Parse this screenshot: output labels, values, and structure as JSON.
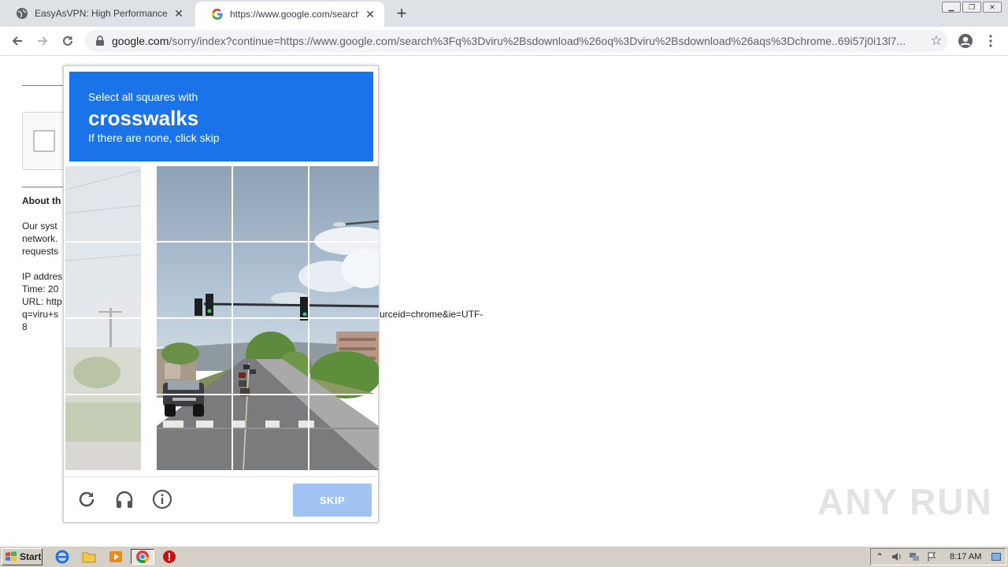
{
  "tabs": [
    {
      "title": "EasyAsVPN: High Performance, Anon",
      "active": false
    },
    {
      "title": "https://www.google.com/search?q=",
      "active": true
    }
  ],
  "toolbar": {
    "url_host": "google.com",
    "url_rest": "/sorry/index?continue=https://www.google.com/search%3Fq%3Dviru%2Bsdownload%26oq%3Dviru%2Bsdownload%26aqs%3Dchrome..69i57j0i13l7..."
  },
  "page": {
    "about_heading": "About th",
    "para1": [
      "Our syst",
      "network.",
      "requests"
    ],
    "info": [
      "IP addres",
      "Time: 20",
      "URL: http",
      "q=viru+s",
      "8"
    ],
    "url_tail": "urceid=chrome&ie=UTF-"
  },
  "captcha": {
    "instruction": "Select all squares with",
    "target": "crosswalks",
    "hint": "If there are none, click skip",
    "skip_label": "SKIP",
    "header_color": "#1a73e8"
  },
  "watermark": "ANY RUN",
  "taskbar": {
    "start_label": "Start",
    "clock": "8:17 AM"
  }
}
